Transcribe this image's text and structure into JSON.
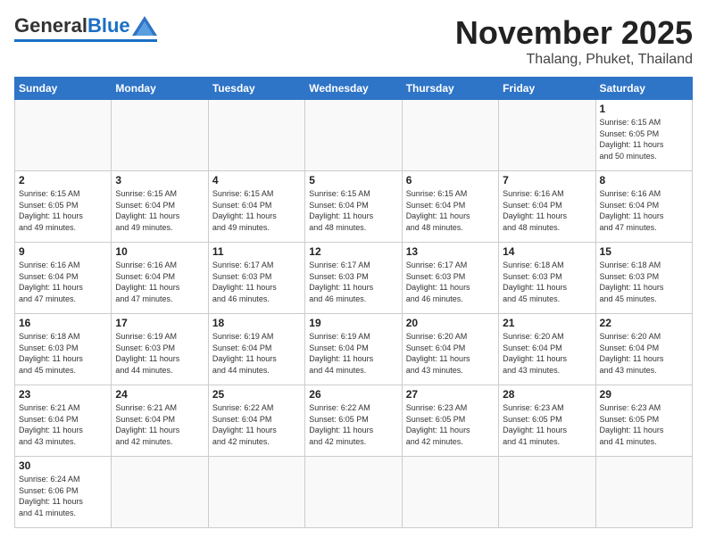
{
  "logo": {
    "general": "General",
    "blue": "Blue"
  },
  "header": {
    "month": "November 2025",
    "location": "Thalang, Phuket, Thailand"
  },
  "weekdays": [
    "Sunday",
    "Monday",
    "Tuesday",
    "Wednesday",
    "Thursday",
    "Friday",
    "Saturday"
  ],
  "weeks": [
    [
      {
        "day": "",
        "info": ""
      },
      {
        "day": "",
        "info": ""
      },
      {
        "day": "",
        "info": ""
      },
      {
        "day": "",
        "info": ""
      },
      {
        "day": "",
        "info": ""
      },
      {
        "day": "",
        "info": ""
      },
      {
        "day": "1",
        "info": "Sunrise: 6:15 AM\nSunset: 6:05 PM\nDaylight: 11 hours\nand 50 minutes."
      }
    ],
    [
      {
        "day": "2",
        "info": "Sunrise: 6:15 AM\nSunset: 6:05 PM\nDaylight: 11 hours\nand 49 minutes."
      },
      {
        "day": "3",
        "info": "Sunrise: 6:15 AM\nSunset: 6:04 PM\nDaylight: 11 hours\nand 49 minutes."
      },
      {
        "day": "4",
        "info": "Sunrise: 6:15 AM\nSunset: 6:04 PM\nDaylight: 11 hours\nand 49 minutes."
      },
      {
        "day": "5",
        "info": "Sunrise: 6:15 AM\nSunset: 6:04 PM\nDaylight: 11 hours\nand 48 minutes."
      },
      {
        "day": "6",
        "info": "Sunrise: 6:15 AM\nSunset: 6:04 PM\nDaylight: 11 hours\nand 48 minutes."
      },
      {
        "day": "7",
        "info": "Sunrise: 6:16 AM\nSunset: 6:04 PM\nDaylight: 11 hours\nand 48 minutes."
      },
      {
        "day": "8",
        "info": "Sunrise: 6:16 AM\nSunset: 6:04 PM\nDaylight: 11 hours\nand 47 minutes."
      }
    ],
    [
      {
        "day": "9",
        "info": "Sunrise: 6:16 AM\nSunset: 6:04 PM\nDaylight: 11 hours\nand 47 minutes."
      },
      {
        "day": "10",
        "info": "Sunrise: 6:16 AM\nSunset: 6:04 PM\nDaylight: 11 hours\nand 47 minutes."
      },
      {
        "day": "11",
        "info": "Sunrise: 6:17 AM\nSunset: 6:03 PM\nDaylight: 11 hours\nand 46 minutes."
      },
      {
        "day": "12",
        "info": "Sunrise: 6:17 AM\nSunset: 6:03 PM\nDaylight: 11 hours\nand 46 minutes."
      },
      {
        "day": "13",
        "info": "Sunrise: 6:17 AM\nSunset: 6:03 PM\nDaylight: 11 hours\nand 46 minutes."
      },
      {
        "day": "14",
        "info": "Sunrise: 6:18 AM\nSunset: 6:03 PM\nDaylight: 11 hours\nand 45 minutes."
      },
      {
        "day": "15",
        "info": "Sunrise: 6:18 AM\nSunset: 6:03 PM\nDaylight: 11 hours\nand 45 minutes."
      }
    ],
    [
      {
        "day": "16",
        "info": "Sunrise: 6:18 AM\nSunset: 6:03 PM\nDaylight: 11 hours\nand 45 minutes."
      },
      {
        "day": "17",
        "info": "Sunrise: 6:19 AM\nSunset: 6:03 PM\nDaylight: 11 hours\nand 44 minutes."
      },
      {
        "day": "18",
        "info": "Sunrise: 6:19 AM\nSunset: 6:04 PM\nDaylight: 11 hours\nand 44 minutes."
      },
      {
        "day": "19",
        "info": "Sunrise: 6:19 AM\nSunset: 6:04 PM\nDaylight: 11 hours\nand 44 minutes."
      },
      {
        "day": "20",
        "info": "Sunrise: 6:20 AM\nSunset: 6:04 PM\nDaylight: 11 hours\nand 43 minutes."
      },
      {
        "day": "21",
        "info": "Sunrise: 6:20 AM\nSunset: 6:04 PM\nDaylight: 11 hours\nand 43 minutes."
      },
      {
        "day": "22",
        "info": "Sunrise: 6:20 AM\nSunset: 6:04 PM\nDaylight: 11 hours\nand 43 minutes."
      }
    ],
    [
      {
        "day": "23",
        "info": "Sunrise: 6:21 AM\nSunset: 6:04 PM\nDaylight: 11 hours\nand 43 minutes."
      },
      {
        "day": "24",
        "info": "Sunrise: 6:21 AM\nSunset: 6:04 PM\nDaylight: 11 hours\nand 42 minutes."
      },
      {
        "day": "25",
        "info": "Sunrise: 6:22 AM\nSunset: 6:04 PM\nDaylight: 11 hours\nand 42 minutes."
      },
      {
        "day": "26",
        "info": "Sunrise: 6:22 AM\nSunset: 6:05 PM\nDaylight: 11 hours\nand 42 minutes."
      },
      {
        "day": "27",
        "info": "Sunrise: 6:23 AM\nSunset: 6:05 PM\nDaylight: 11 hours\nand 42 minutes."
      },
      {
        "day": "28",
        "info": "Sunrise: 6:23 AM\nSunset: 6:05 PM\nDaylight: 11 hours\nand 41 minutes."
      },
      {
        "day": "29",
        "info": "Sunrise: 6:23 AM\nSunset: 6:05 PM\nDaylight: 11 hours\nand 41 minutes."
      }
    ],
    [
      {
        "day": "30",
        "info": "Sunrise: 6:24 AM\nSunset: 6:06 PM\nDaylight: 11 hours\nand 41 minutes."
      },
      {
        "day": "",
        "info": ""
      },
      {
        "day": "",
        "info": ""
      },
      {
        "day": "",
        "info": ""
      },
      {
        "day": "",
        "info": ""
      },
      {
        "day": "",
        "info": ""
      },
      {
        "day": "",
        "info": ""
      }
    ]
  ]
}
